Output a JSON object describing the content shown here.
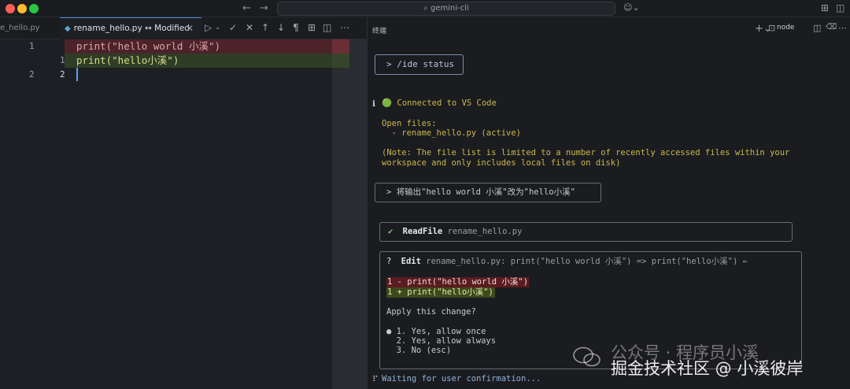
{
  "titlebar": {
    "search_text": "⌕ gemini-cli",
    "back_icon": "←",
    "forward_icon": "→",
    "copilot_icon": "☺⌄",
    "colors": {
      "close": "#ff5f57",
      "minimize": "#febc2e",
      "maximize": "#28c840"
    }
  },
  "tabs": {
    "inactive_label": "e_hello.py",
    "active_label": "rename_hello.py ↔ Modified",
    "active_icon": "◆",
    "close_icon": "✕",
    "toolbar": [
      "▷",
      "⌄",
      "✓",
      "✕",
      "↑",
      "↓",
      "¶",
      "⊞",
      "⋯"
    ]
  },
  "editor": {
    "line_numbers_orig": [
      "1",
      "2"
    ],
    "line_numbers_mod": [
      "1+",
      "2"
    ],
    "del_mark": "−",
    "deleted_line": "print(\"hello world 小溪\")",
    "added_line": "print(\"hello小溪\")"
  },
  "panel": {
    "title": "终端",
    "plus_icon": "+⌄",
    "terminal_icon": "⊡",
    "node_label": "node",
    "split_icon": "◫",
    "trash_icon": "🗑",
    "more_icon": "⋯",
    "ide_status_cmd": "> /ide status",
    "info_marker": "ℹ",
    "connected": "🟢 Connected to VS Code",
    "open_files_label": "Open files:",
    "open_file": "  - rename_hello.py (active)",
    "note_line1": "(Note: The file list is limited to a number of recently accessed files within your",
    "note_line2": "workspace and only includes local files on disk)",
    "user_prompt": "> 将输出\"hello world 小溪\"改为\"hello小溪\"",
    "readfile_check": "✔",
    "readfile_tool": "ReadFile",
    "readfile_arg": "rename_hello.py",
    "edit_marker": "?",
    "edit_tool": "Edit",
    "edit_arg": "rename_hello.py: print(\"hello world 小溪\") => print(\"hello小溪\") ←",
    "diff_del": "1 - print(\"hello world 小溪\")",
    "diff_add": "1 + print(\"hello小溪\")",
    "apply_question": "Apply this change?",
    "options": [
      "● 1. Yes, allow once",
      "  2. Yes, allow always",
      "  3. No (esc)"
    ],
    "spinner": "⠏",
    "waiting": "Waiting for user confirmation..."
  },
  "watermark": {
    "line1": "公众号 · 程序员小溪",
    "line2": "掘金技术社区 @ 小溪彼岸"
  }
}
